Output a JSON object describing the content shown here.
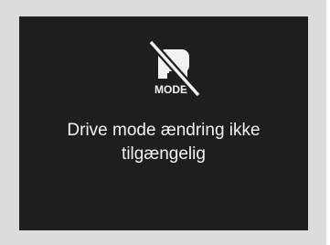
{
  "display": {
    "icon": {
      "name": "drive-mode-unavailable-icon",
      "label": "MODE"
    },
    "message_line1": "Drive mode ændring ikke",
    "message_line2": "tilgængelig"
  },
  "colors": {
    "frame": "#dcdcdc",
    "screen": "#1e1e1e",
    "foreground": "#f2f2f2"
  }
}
